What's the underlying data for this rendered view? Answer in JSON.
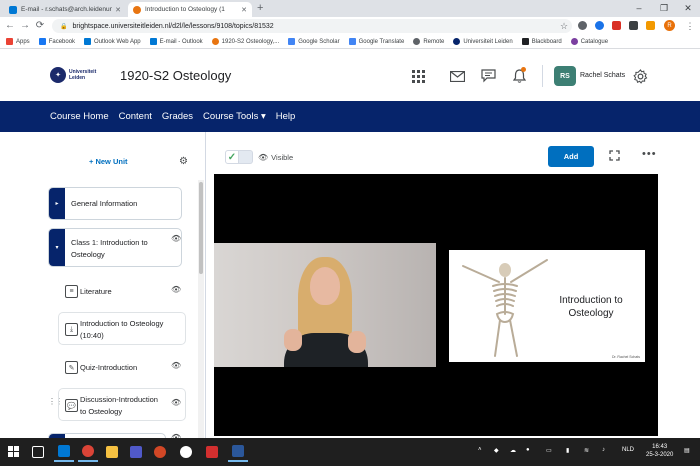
{
  "browser": {
    "tabs": [
      {
        "title": "E-mail - r.schats@arch.leidenuniv.nl",
        "favicon_color": "#0078d4"
      },
      {
        "title": "Introduction to Osteology (1",
        "favicon_color": "#e87511"
      }
    ],
    "new_tab": "+",
    "window_controls": [
      "–",
      "❐",
      "✕"
    ],
    "url": "brightspace.universiteitleiden.nl/d2l/le/lessons/9108/topics/81532",
    "nav": {
      "back": "←",
      "forward": "→",
      "reload": "⟳"
    },
    "profile_initial": "R",
    "bookmarks": [
      {
        "label": "Apps",
        "color": "#ea4335"
      },
      {
        "label": "Facebook",
        "color": "#1877f2"
      },
      {
        "label": "Outlook Web App",
        "color": "#0078d4"
      },
      {
        "label": "E-mail - Outlook",
        "color": "#0078d4"
      },
      {
        "label": "1920-S2 Osteology,...",
        "color": "#e87511"
      },
      {
        "label": "Google Scholar",
        "color": "#4285f4"
      },
      {
        "label": "Google Translate",
        "color": "#4285f4"
      },
      {
        "label": "Remote",
        "color": "#5f6368"
      },
      {
        "label": "Universiteit Leiden",
        "color": "#06246b"
      },
      {
        "label": "Blackboard",
        "color": "#202124"
      },
      {
        "label": "Catalogue",
        "color": "#7b3fa0"
      }
    ]
  },
  "header": {
    "university_line1": "Universiteit",
    "university_line2": "Leiden",
    "course_title": "1920-S2 Osteology",
    "user_initials": "RS",
    "user_name": "Rachel Schats"
  },
  "navbar": {
    "items": [
      "Course Home",
      "Content",
      "Grades",
      "Course Tools ▾",
      "Help"
    ]
  },
  "sidebar": {
    "new_unit": "+ New Unit",
    "units": [
      {
        "label": "General Information",
        "chevron": "▸"
      },
      {
        "label_line1": "Class 1: Introduction to",
        "label_line2": "Osteology",
        "chevron": "▾"
      }
    ],
    "lessons": [
      {
        "label": "Literature"
      },
      {
        "label_line1": "Introduction to Osteology",
        "label_line2": "(10:40)"
      },
      {
        "label": "Quiz-Introduction"
      },
      {
        "label_line1": "Discussion-Introduction",
        "label_line2": "to Osteology"
      }
    ]
  },
  "topic": {
    "visibility_label": "Visible",
    "add_button": "Add",
    "more": "•••"
  },
  "video": {
    "slide_title": "Introduction to Osteology",
    "slide_credit": "Dr. Rachel Schats"
  },
  "taskbar": {
    "time": "16:43",
    "date": "25-3-2020",
    "language": "NLD"
  },
  "colors": {
    "brand_navy": "#06246b",
    "accent_blue": "#006fbf",
    "visible_green": "#46a661",
    "avatar_teal": "#3d7f74"
  }
}
